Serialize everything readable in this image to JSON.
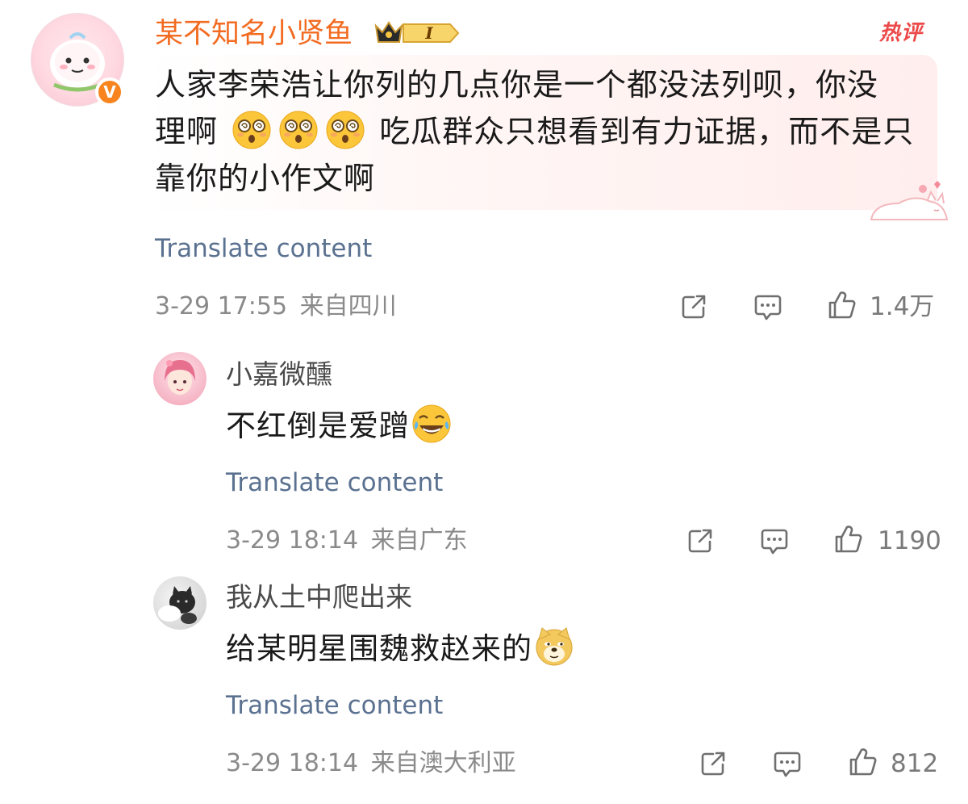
{
  "main_comment": {
    "username": "某不知名小贤鱼",
    "level_badge": "I",
    "hot_tag": "热评",
    "text_line1": "人家李荣浩让你列的几点你是一个都没法列呗，你没",
    "text_line2_start": "理啊",
    "text_line2_end": "吃瓜群众只想看到有力证据，而不是只",
    "text_line3": "靠你的小作文啊",
    "translate": "Translate content",
    "timestamp": "3-29 17:55",
    "location": "来自四川",
    "like_count": "1.4万",
    "verified_icon": "v-verified-icon",
    "text_emoji": "dizzy-face-emoji"
  },
  "replies": [
    {
      "username": "小嘉微醺",
      "text": "不红倒是爱蹭",
      "emoji": "laughing-tears-emoji",
      "translate": "Translate content",
      "timestamp": "3-29 18:14",
      "location": "来自广东",
      "like_count": "1190"
    },
    {
      "username": "我从土中爬出来",
      "text": "给某明星围魏救赵来的",
      "emoji": "doge-emoji",
      "translate": "Translate content",
      "timestamp": "3-29 18:14",
      "location": "来自澳大利亚",
      "like_count": "812"
    }
  ],
  "colors": {
    "username_main": "#f26b21",
    "translate_link": "#5a7190",
    "meta_gray": "#8a8a8a",
    "hot_red": "#ec4a4a",
    "verified_orange": "#f7841f"
  }
}
